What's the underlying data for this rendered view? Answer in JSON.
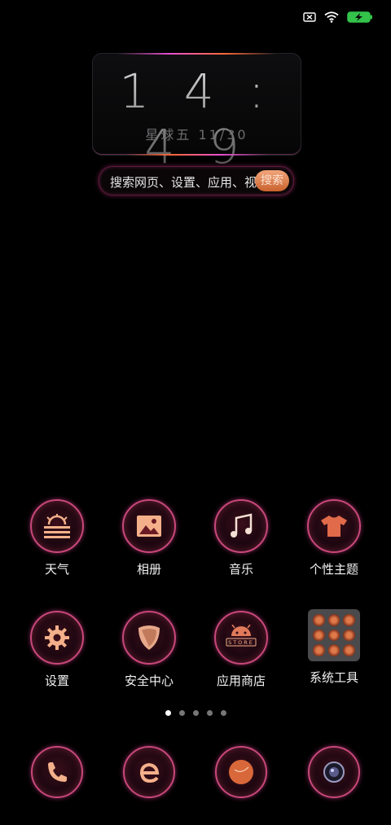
{
  "status_bar": {
    "icons": [
      "sim-missing-icon",
      "wifi-icon",
      "battery-charging-icon"
    ]
  },
  "clock": {
    "time": "14:49",
    "date": "星球五 11/30"
  },
  "search": {
    "placeholder": "搜索网页、设置、应用、视频",
    "button": "搜索"
  },
  "apps": [
    {
      "label": "天气",
      "icon": "weather-icon"
    },
    {
      "label": "相册",
      "icon": "gallery-icon"
    },
    {
      "label": "音乐",
      "icon": "music-icon"
    },
    {
      "label": "个性主题",
      "icon": "themes-icon"
    },
    {
      "label": "设置",
      "icon": "settings-gear-icon"
    },
    {
      "label": "安全中心",
      "icon": "security-shield-icon"
    },
    {
      "label": "应用商店",
      "icon": "app-store-icon"
    },
    {
      "label": "系统工具",
      "icon": "system-tools-folder-icon"
    }
  ],
  "page_indicator": {
    "pages": 5,
    "current": 1
  },
  "dock": [
    {
      "icon": "phone-icon"
    },
    {
      "icon": "browser-icon"
    },
    {
      "icon": "messages-icon"
    },
    {
      "icon": "camera-icon"
    }
  ],
  "colors": {
    "accent": "#c8487a",
    "search_button": "#e0834f",
    "background": "#000000"
  }
}
